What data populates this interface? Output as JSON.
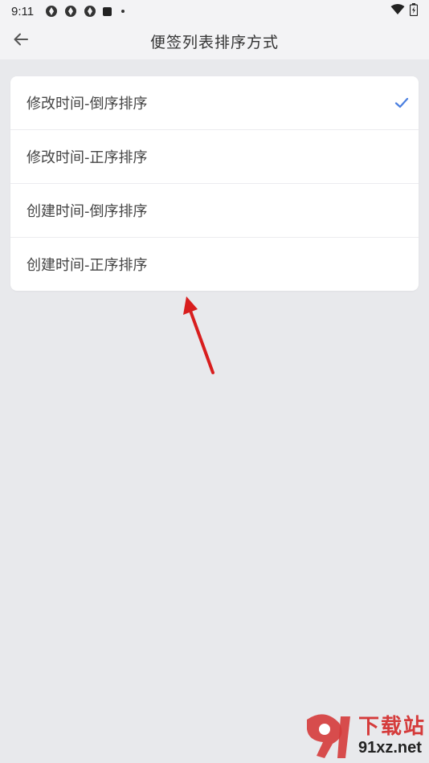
{
  "status_bar": {
    "time": "9:11",
    "icons": [
      "sync-icon",
      "sync-icon",
      "sync-icon",
      "square-icon",
      "dot-icon",
      "wifi-icon",
      "battery-icon"
    ]
  },
  "app_bar": {
    "title": "便签列表排序方式",
    "back_icon": "arrow-left-icon"
  },
  "sort_options": [
    {
      "label": "修改时间-倒序排序",
      "selected": true
    },
    {
      "label": "修改时间-正序排序",
      "selected": false
    },
    {
      "label": "创建时间-倒序排序",
      "selected": false
    },
    {
      "label": "创建时间-正序排序",
      "selected": false
    }
  ],
  "colors": {
    "accent": "#4a7fe0",
    "annotation_arrow": "#d81e1e",
    "background": "#e8e9ec",
    "watermark_red": "#d53b3b"
  },
  "watermark": {
    "title": "下载站",
    "url": "91xz.net"
  }
}
